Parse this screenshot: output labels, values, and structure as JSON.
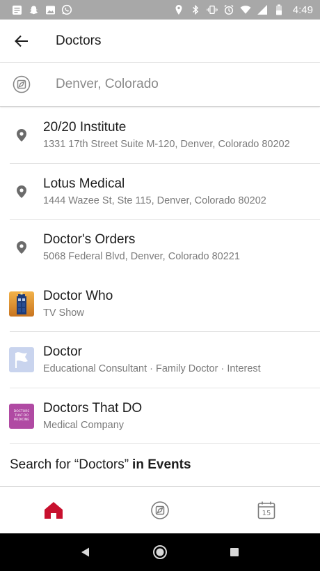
{
  "status_bar": {
    "time": "4:49",
    "left_icons": [
      "notification-icon",
      "snapchat-icon",
      "gallery-icon",
      "whatsapp-icon"
    ],
    "right_icons": [
      "location-icon",
      "bluetooth-icon",
      "vibrate-icon",
      "alarm-icon",
      "wifi-icon",
      "signal-icon",
      "battery-icon"
    ]
  },
  "header": {
    "title": "Doctors"
  },
  "search": {
    "location": "Denver, Colorado"
  },
  "results": [
    {
      "title": "20/20 Institute",
      "subtitle": "1331 17th Street Suite M-120, Denver, Colorado 80202",
      "icon": "location-pin-icon"
    },
    {
      "title": "Lotus Medical",
      "subtitle": "1444 Wazee St, Ste 115, Denver, Colorado 80202",
      "icon": "location-pin-icon"
    },
    {
      "title": "Doctor's Orders",
      "subtitle": "5068 Federal Blvd, Denver, Colorado 80221",
      "icon": "location-pin-icon"
    },
    {
      "title": "Doctor Who",
      "subtitle": "TV Show",
      "icon": "tardis-thumbnail"
    },
    {
      "title": "Doctor",
      "subtitle": "Educational Consultant · Family Doctor · Interest",
      "icon": "flag-thumbnail"
    },
    {
      "title": "Doctors That DO",
      "subtitle": "Medical Company",
      "icon": "dtd-logo-thumbnail",
      "logo_text": [
        "DOCTORS",
        "THAT DO",
        "MEDICINE"
      ]
    }
  ],
  "search_events": {
    "prefix": "Search for “Doctors”",
    "suffix": "in Events"
  },
  "bottom_nav": {
    "calendar_day": "15",
    "active_color": "#c8102e"
  },
  "colors": {
    "accent": "#c8102e",
    "status_bar": "#a8a8a8",
    "pin": "#6b6b6b"
  }
}
